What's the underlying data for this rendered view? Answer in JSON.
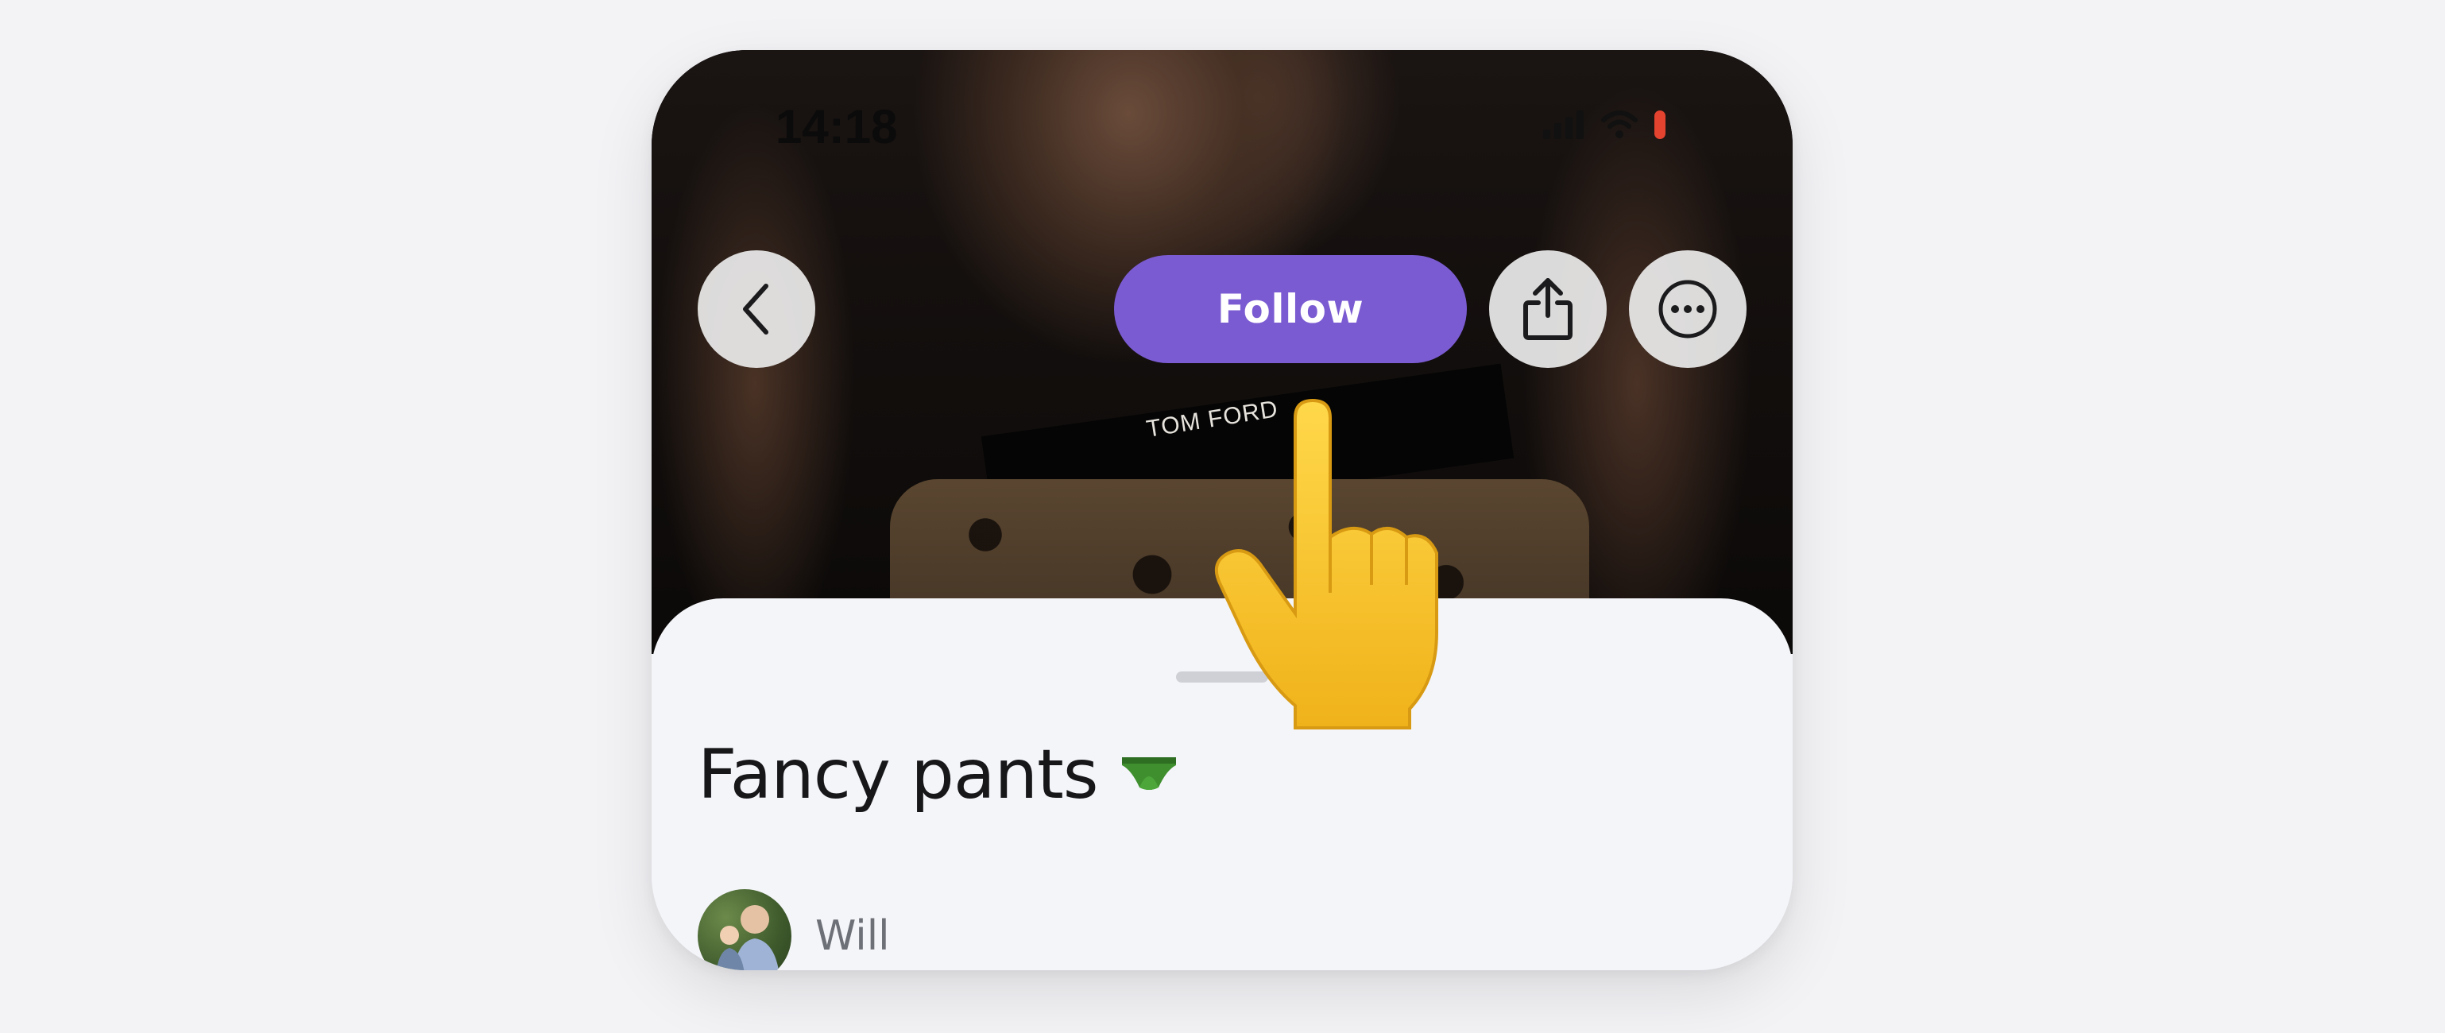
{
  "status_bar": {
    "time": "14:18"
  },
  "toolbar": {
    "follow_label": "Follow"
  },
  "hero": {
    "brand_text": "TOM FORD"
  },
  "post": {
    "title": "Fancy pants",
    "title_icon": "green-briefs-icon",
    "author_name": "Will"
  },
  "colors": {
    "accent": "#7b5bd2",
    "background": "#f3f3f6",
    "sheet": "#f4f5f9",
    "battery": "#e4432f",
    "author_text": "#6e7078"
  }
}
